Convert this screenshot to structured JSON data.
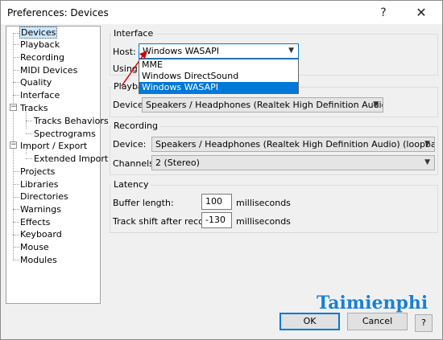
{
  "window": {
    "title": "Preferences: Devices",
    "help_glyph": "?",
    "close_glyph": "✕"
  },
  "tree": {
    "items": [
      {
        "label": "Devices"
      },
      {
        "label": "Playback"
      },
      {
        "label": "Recording"
      },
      {
        "label": "MIDI Devices"
      },
      {
        "label": "Quality"
      },
      {
        "label": "Interface"
      },
      {
        "label": "Tracks"
      },
      {
        "label": "Tracks Behaviors"
      },
      {
        "label": "Spectrograms"
      },
      {
        "label": "Import / Export"
      },
      {
        "label": "Extended Import"
      },
      {
        "label": "Projects"
      },
      {
        "label": "Libraries"
      },
      {
        "label": "Directories"
      },
      {
        "label": "Warnings"
      },
      {
        "label": "Effects"
      },
      {
        "label": "Keyboard"
      },
      {
        "label": "Mouse"
      },
      {
        "label": "Modules"
      }
    ],
    "expander_glyph": "−"
  },
  "interface": {
    "group": "Interface",
    "host_label": "Host:",
    "host_value": "Windows WASAPI",
    "using_label": "Using:",
    "options": [
      "MME",
      "Windows DirectSound",
      "Windows WASAPI"
    ]
  },
  "playback": {
    "group": "Playba",
    "device_label": "Device:",
    "device_value": "Speakers / Headphones (Realtek High Definition Audio)"
  },
  "recording": {
    "group": "Recording",
    "device_label": "Device:",
    "device_value": "Speakers / Headphones (Realtek High Definition Audio) (loopback)",
    "channels_label": "Channels:",
    "channels_value": "2 (Stereo)"
  },
  "latency": {
    "group": "Latency",
    "buffer_label": "Buffer length:",
    "buffer_value": "100",
    "buffer_unit": "milliseconds",
    "shift_label": "Track shift after record:",
    "shift_value": "-130",
    "shift_unit": "milliseconds"
  },
  "buttons": {
    "ok": "OK",
    "cancel": "Cancel",
    "help": "?"
  },
  "watermark": "Taimienphi",
  "colors": {
    "selection": "#0078d7",
    "accent_arrow": "#d40000"
  }
}
